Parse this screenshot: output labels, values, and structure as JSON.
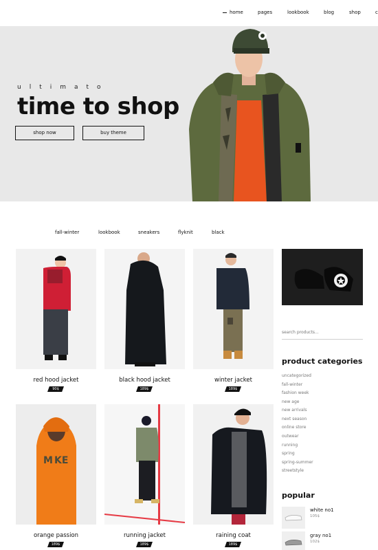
{
  "nav": {
    "items": [
      {
        "label": "home",
        "active": true
      },
      {
        "label": "pages"
      },
      {
        "label": "lookbook"
      },
      {
        "label": "blog"
      },
      {
        "label": "shop"
      },
      {
        "label": "c"
      }
    ]
  },
  "hero": {
    "eyebrow": "ultimato",
    "title": "time to shop",
    "button_shop": "shop now",
    "button_theme": "buy theme"
  },
  "filters": [
    "fall-winter",
    "lookbook",
    "sneakers",
    "flyknit",
    "black"
  ],
  "products": [
    {
      "name": "red hood jacket",
      "price": "90$"
    },
    {
      "name": "black hood jacket",
      "price": "189$"
    },
    {
      "name": "winter jacket",
      "price": "189$"
    },
    {
      "name": "orange passion",
      "price": "189$"
    },
    {
      "name": "running jacket",
      "price": "189$"
    },
    {
      "name": "raining coat",
      "price": "189$"
    }
  ],
  "sidebar": {
    "search_placeholder": "search products...",
    "categories_title": "product categories",
    "categories": [
      "uncategorized",
      "fall-winter",
      "fashion week",
      "new age",
      "new arrivals",
      "next season",
      "online store",
      "outwear",
      "running",
      "spring",
      "spring-summer",
      "streetstyle"
    ],
    "popular_title": "popular",
    "popular": [
      {
        "name": "white no1",
        "price": "105$"
      },
      {
        "name": "gray no1",
        "price": "102$"
      }
    ]
  },
  "colors": {
    "accent": "#111111",
    "hero_bg": "#e8e8e8"
  }
}
